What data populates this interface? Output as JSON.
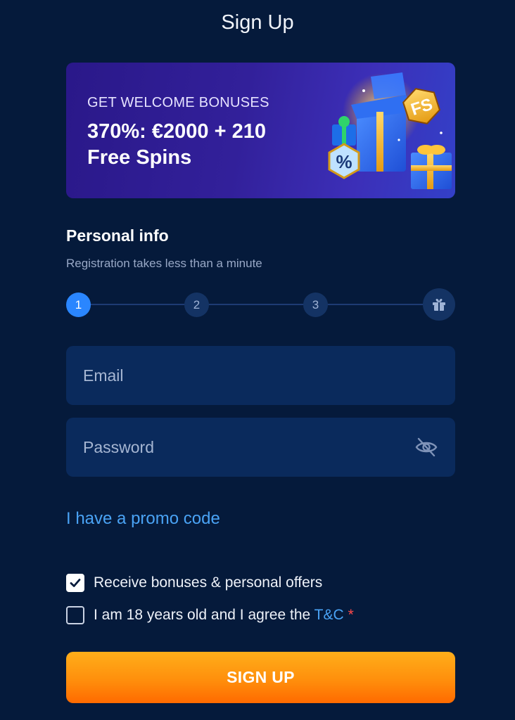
{
  "header": {
    "title": "Sign Up"
  },
  "banner": {
    "eyebrow": "GET WELCOME BONUSES",
    "headline": "370%: €2000 + 210 Free Spins",
    "badge_text": "FS",
    "percent_text": "%"
  },
  "personal": {
    "title": "Personal info",
    "subtitle": "Registration takes less than a minute"
  },
  "stepper": {
    "steps": [
      "1",
      "2",
      "3"
    ],
    "active_step": 1,
    "final_icon": "gift-icon"
  },
  "form": {
    "email_placeholder": "Email",
    "password_placeholder": "Password",
    "password_toggle_icon": "eye-off-icon"
  },
  "promo_link": "I have a promo code",
  "consents": {
    "bonuses": {
      "label": "Receive bonuses & personal offers",
      "checked": true
    },
    "age": {
      "label_prefix": "I am 18 years old and I agree the",
      "link": "T&C",
      "required_mark": "*",
      "checked": false
    }
  },
  "actions": {
    "signup_label": "SIGN UP"
  },
  "colors": {
    "background": "#051a3b",
    "field": "#0a2a5c",
    "accent_blue": "#2a86ff",
    "link": "#4aa3f5",
    "cta_top": "#ffae1a",
    "cta_bottom": "#ff6a00",
    "required": "#ff4a4a"
  }
}
